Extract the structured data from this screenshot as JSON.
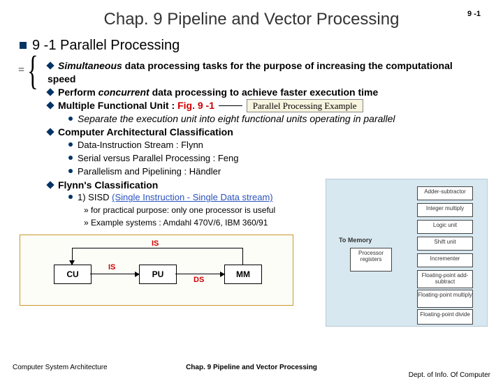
{
  "page_number": "9 -1",
  "chapter_title": "Chap. 9  Pipeline and Vector Processing",
  "section_heading": "9 -1  Parallel Processing",
  "eq_sign": "=",
  "bullets": {
    "b1a": "Simultaneous",
    "b1b": " data processing tasks for the purpose of increasing the computational speed",
    "b2a": "Perform ",
    "b2b": "concurrent",
    "b2c": " data processing to achieve faster execution time",
    "b3a": "Multiple Functional Unit : ",
    "b3_fig": "Fig. 9 -1",
    "b3_callout": "Parallel Processing Example",
    "b3_sub": "Separate the execution unit into eight functional units operating in parallel",
    "b4": "Computer Architectural Classification",
    "b4_s1": "Data-Instruction Stream : Flynn",
    "b4_s2": "Serial versus Parallel Processing : Feng",
    "b4_s3": "Parallelism and Pipelining : Händler",
    "b5": "Flynn's Classification",
    "b5_s1a": "1) SISD ",
    "b5_s1b": "(Single Instruction - Single Data stream)",
    "b5_s1_e1": "for practical purpose: only one processor is useful",
    "b5_s1_e2": "Example systems : Amdahl 470V/6,  IBM 360/91"
  },
  "sisd": {
    "is_top": "IS",
    "is_mid": "IS",
    "ds": "DS",
    "cu": "CU",
    "pu": "PU",
    "mm": "MM"
  },
  "right_diag": {
    "to_memory": "To Memory",
    "adder": "Adder-subtractor",
    "intmul": "Integer multiply",
    "logic": "Logic unit",
    "shift": "Shift unit",
    "inc": "Incrementer",
    "proc_reg": "Processor registers",
    "fpadd": "Floating-point add-subtract",
    "fpmul": "Floating-point multiply",
    "fpdiv": "Floating-point divide"
  },
  "footer": {
    "left": "Computer System Architecture",
    "center": "Chap. 9 Pipeline and Vector Processing",
    "right": "Dept. of  Info. Of  Computer"
  }
}
